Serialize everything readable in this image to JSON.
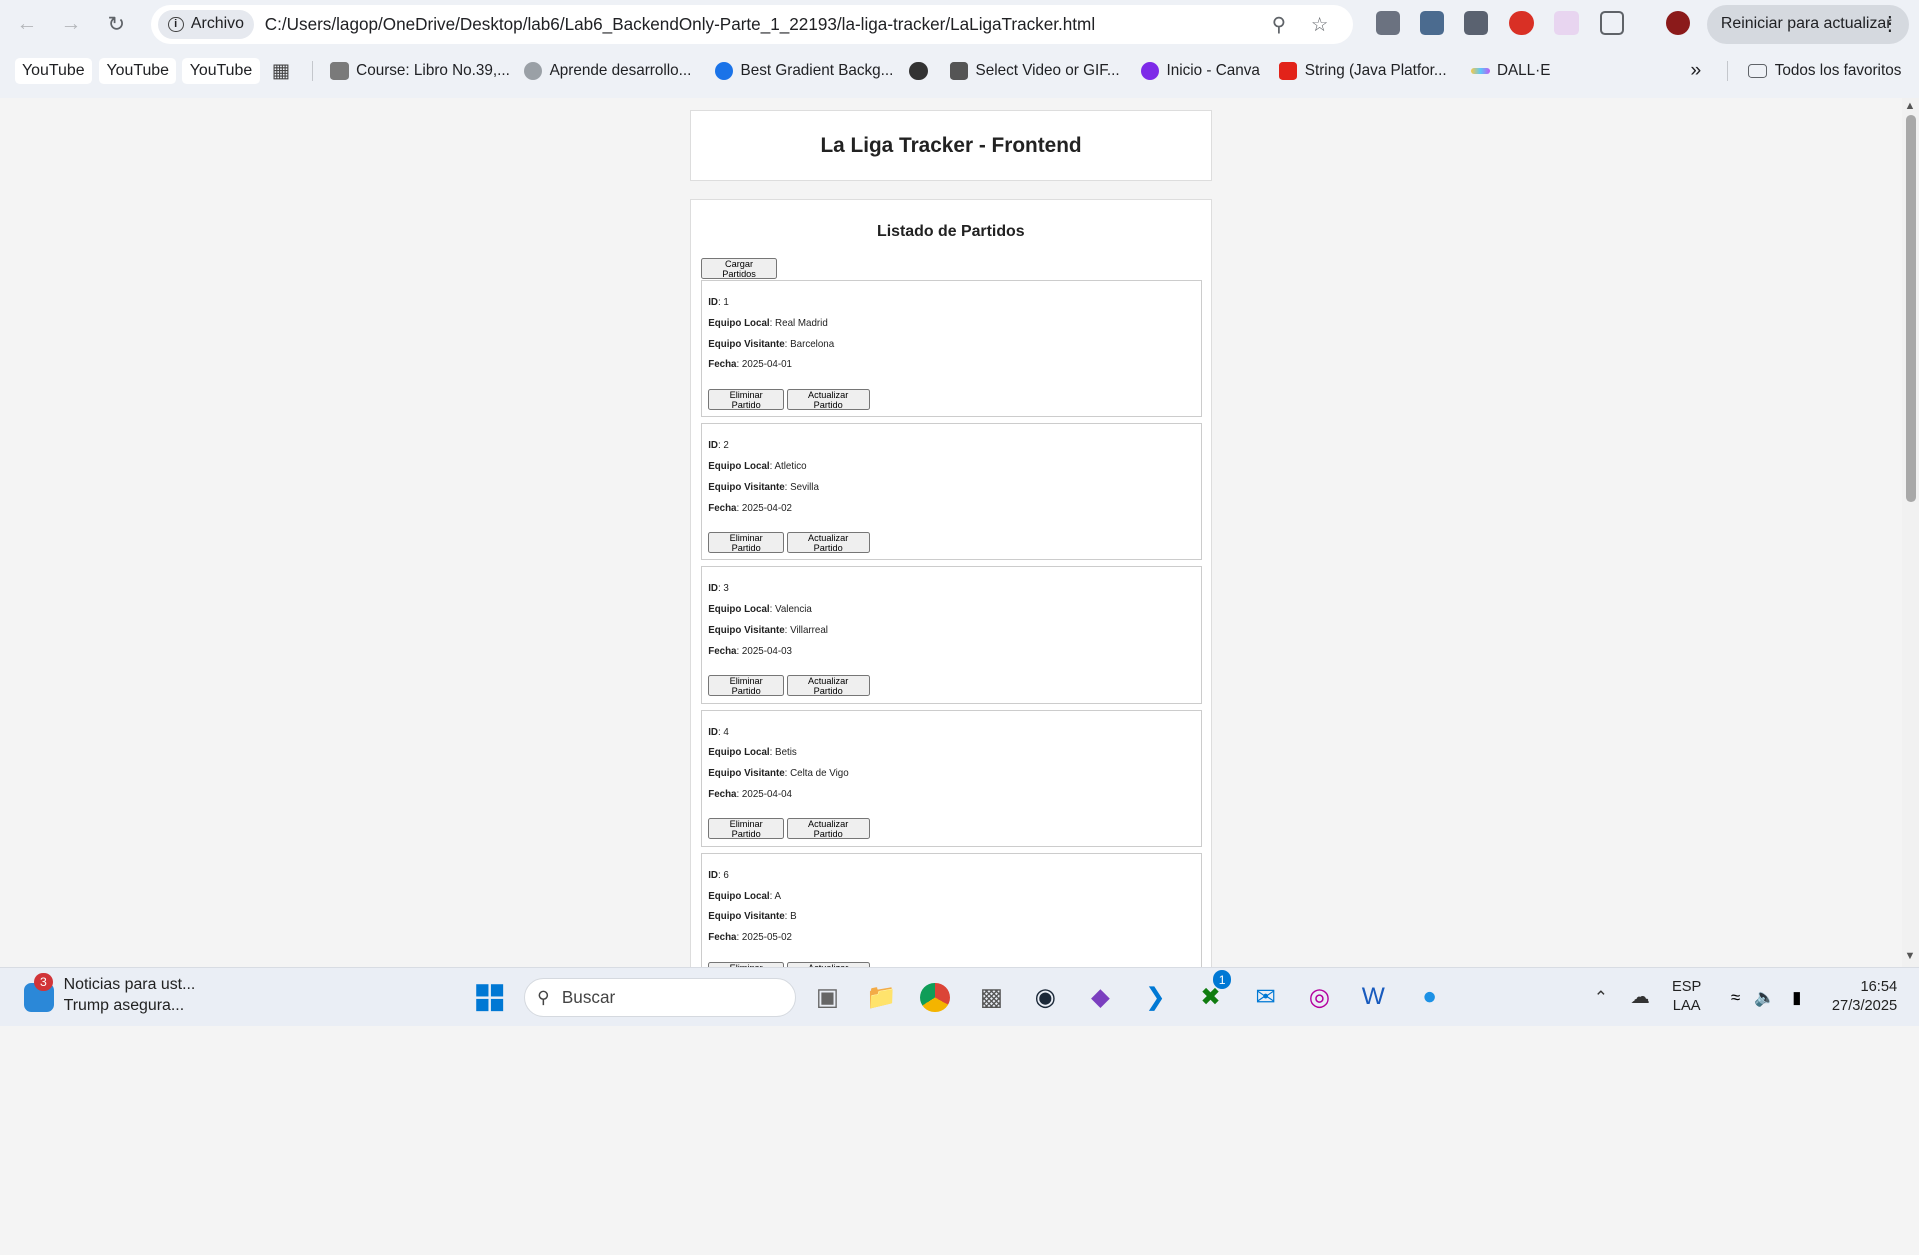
{
  "browser": {
    "chip_label": "Archivo",
    "url": "C:/Users/lagop/OneDrive/Desktop/lab6/Lab6_BackendOnly-Parte_1_22193/la-liga-tracker/LaLigaTracker.html",
    "update_button": "Reiniciar para actualizar",
    "bookmarks": [
      "YouTube",
      "YouTube",
      "YouTube",
      "Course: Libro No.39,...",
      "Aprende desarrollo...",
      "Best Gradient Backg...",
      "Select Video or GIF...",
      "Inicio - Canva",
      "String (Java Platfor...",
      "DALL·E"
    ],
    "all_bookmarks": "Todos los favoritos"
  },
  "page": {
    "title": "La Liga Tracker - Frontend",
    "list_title": "Listado de Partidos",
    "load_button": "Cargar Partidos",
    "labels": {
      "id": "ID",
      "home": "Equipo Local",
      "away": "Equipo Visitante",
      "date": "Fecha"
    },
    "delete_button": "Eliminar Partido",
    "update_button": "Actualizar Partido",
    "matches": [
      {
        "id": ": 1",
        "home": ": Real Madrid",
        "away": ": Barcelona",
        "date": ": 2025-04-01"
      },
      {
        "id": ": 2",
        "home": ": Atletico",
        "away": ": Sevilla",
        "date": ": 2025-04-02"
      },
      {
        "id": ": 3",
        "home": ": Valencia",
        "away": ": Villarreal",
        "date": ": 2025-04-03"
      },
      {
        "id": ": 4",
        "home": ": Betis",
        "away": ": Celta de Vigo",
        "date": ": 2025-04-04"
      },
      {
        "id": ": 6",
        "home": ": A",
        "away": ": B",
        "date": ": 2025-05-02"
      }
    ]
  },
  "taskbar": {
    "news_title": "Noticias para ust...",
    "news_sub": "Trump asegura...",
    "news_badge": "3",
    "search": "Buscar",
    "xbox_badge": "1",
    "lang1": "ESP",
    "lang2": "LAA",
    "time": "16:54",
    "date": "27/3/2025"
  }
}
